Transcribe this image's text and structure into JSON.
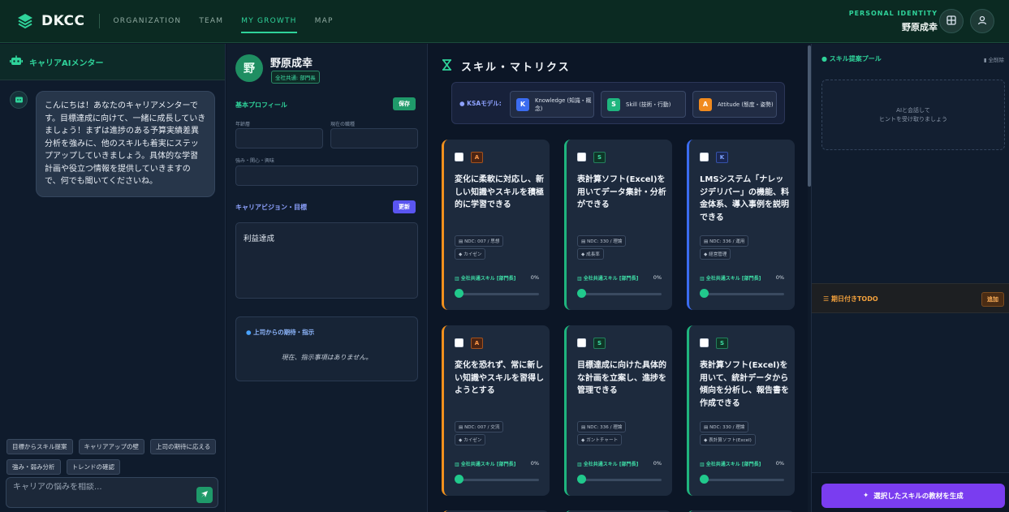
{
  "header": {
    "brand": "DKCC",
    "nav": [
      {
        "label": "ORGANIZATION",
        "active": false
      },
      {
        "label": "TEAM",
        "active": false
      },
      {
        "label": "MY GROWTH",
        "active": true
      },
      {
        "label": "MAP",
        "active": false
      }
    ],
    "identity_label": "PERSONAL IDENTITY",
    "identity_name": "野原成幸",
    "icons": [
      "grid-icon",
      "user-icon"
    ]
  },
  "chat": {
    "title": "キャリアAIメンター",
    "message": "こんにちは！あなたのキャリアメンターです。目標達成に向けて、一緒に成長していきましょう！まずは進捗のある予算実績差異分析を強みに、他のスキルも着実にステップアップしていきましょう。具体的な学習計画や役立つ情報を提供していきますので、何でも聞いてくださいね。",
    "chips": [
      "目標からスキル提案",
      "キャリアアップの壁",
      "上司の期待に応える",
      "強み・弱み分析",
      "トレンドの確認"
    ],
    "input_placeholder": "キャリアの悩みを相談..."
  },
  "profile": {
    "avatar_char": "野",
    "name": "野原成幸",
    "badge": "全社共通: 部門長",
    "basic_label": "基本プロフィール",
    "save_label": "保存",
    "field_years_label": "年齢層",
    "field_role_label": "現在の職種",
    "field_strength_label": "強み・関心・興味",
    "vision_label": "キャリアビジョン・目標",
    "update_label": "更新",
    "vision_text": "利益達成",
    "boss_title": "上司からの期待・指示",
    "boss_empty": "現在、指示事項はありません。"
  },
  "matrix": {
    "title": "スキル・マトリクス",
    "ksa_label": "KSAモデル:",
    "ksa": [
      {
        "letter": "K",
        "text": "Knowledge (知識・概念)",
        "color": "#3b6cf0"
      },
      {
        "letter": "S",
        "text": "Skill (技術・行動)",
        "color": "#1fb57e"
      },
      {
        "letter": "A",
        "text": "Attitude (態度・姿勢)",
        "color": "#f08a1e"
      }
    ],
    "cards": [
      {
        "type": "A",
        "title": "変化に柔軟に対応し、新しい知識やスキルを積極的に学習できる",
        "ndc": "NDC: 007 / 思想",
        "tag": "カイゼン",
        "common": "全社共通スキル [部門長]",
        "pct": "0%"
      },
      {
        "type": "S",
        "title": "表計算ソフト(Excel)を用いてデータ集計・分析ができる",
        "ndc": "NDC: 330 / 理論",
        "tag": "成長率",
        "common": "全社共通スキル [部門長]",
        "pct": "0%"
      },
      {
        "type": "K",
        "title": "LMSシステム「ナレッジデリバー」の機能、料金体系、導入事例を説明できる",
        "ndc": "NDC: 336 / 運用",
        "tag": "経営管理",
        "common": "全社共通スキル [部門長]",
        "pct": "0%"
      },
      {
        "type": "A",
        "title": "変化を恐れず、常に新しい知識やスキルを習得しようとする",
        "ndc": "NDC: 007 / 交流",
        "tag": "カイゼン",
        "common": "全社共通スキル [部門長]",
        "pct": "0%"
      },
      {
        "type": "S",
        "title": "目標達成に向けた具体的な計画を立案し、進捗を管理できる",
        "ndc": "NDC: 336 / 理論",
        "tag": "ガントチャート",
        "common": "全社共通スキル [部門長]",
        "pct": "0%"
      },
      {
        "type": "S",
        "title": "表計算ソフト(Excel)を用いて、統計データから傾向を分析し、報告書を作成できる",
        "ndc": "NDC: 330 / 理論",
        "tag": "表計算ソフト(Excel)",
        "common": "全社共通スキル [部門長]",
        "pct": "0%"
      }
    ]
  },
  "right": {
    "pool_title": "スキル提案プール",
    "clear_all": "全削除",
    "pool_hint_1": "AIと会話して",
    "pool_hint_2": "ヒントを受け取りましょう",
    "todo_label": "期日付きTODO",
    "todo_add": "追加",
    "generate_label": "選択したスキルの教材を生成"
  },
  "colors": {
    "accent": "#2fd39a",
    "A": "#f0901e",
    "S": "#1fb57e",
    "K": "#3b6cf0"
  }
}
